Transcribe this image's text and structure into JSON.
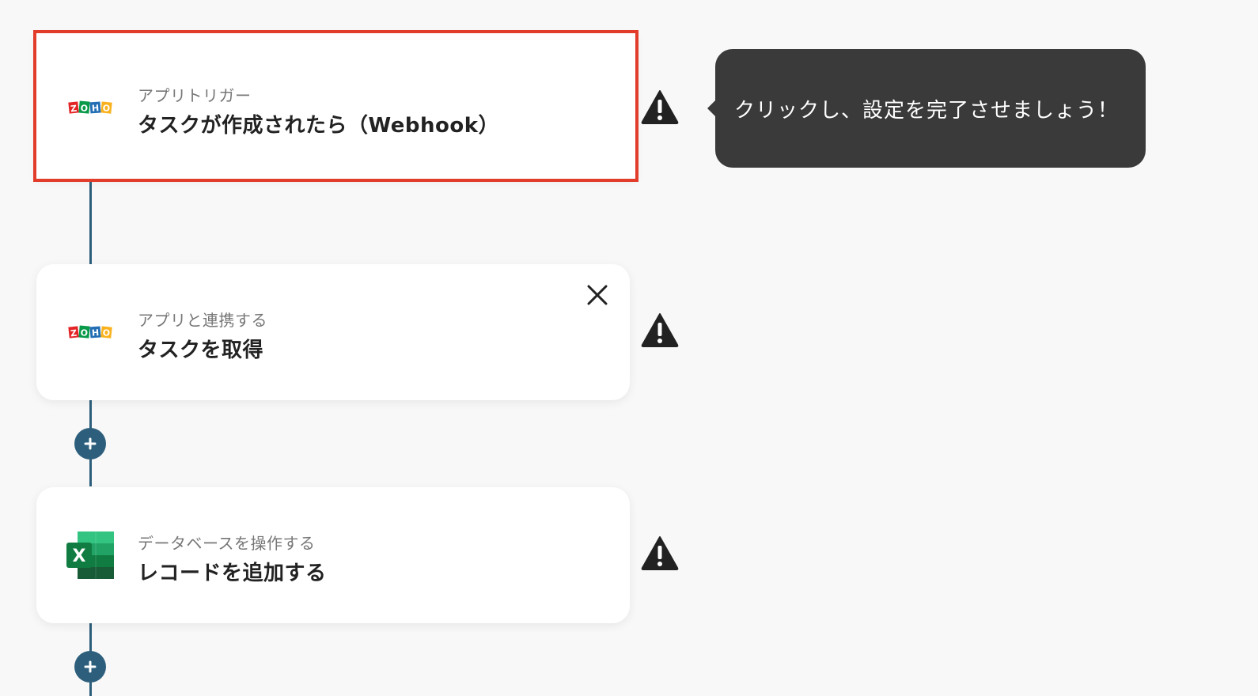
{
  "flow": {
    "steps": [
      {
        "subtitle": "アプリトリガー",
        "title": "タスクが作成されたら（Webhook）",
        "app_icon": "zoho-logo",
        "status_icon": "warning-icon",
        "highlighted": true
      },
      {
        "subtitle": "アプリと連携する",
        "title": "タスクを取得",
        "app_icon": "zoho-logo",
        "status_icon": "warning-icon",
        "close_icon": "close-icon"
      },
      {
        "subtitle": "データベースを操作する",
        "title": "レコードを追加する",
        "app_icon": "excel-logo",
        "status_icon": "warning-icon"
      }
    ],
    "add_icon": "plus-icon"
  },
  "tooltip": {
    "text": "クリックし、設定を完了させましょう！"
  },
  "colors": {
    "connector": "#2d5f7c",
    "highlight_border": "#e23c2a",
    "tooltip_bg": "#3a3a3a",
    "background": "#f8f8f8"
  }
}
